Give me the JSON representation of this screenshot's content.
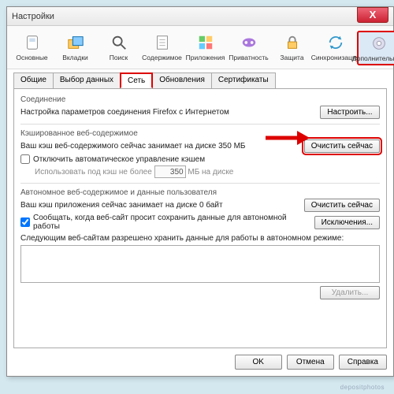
{
  "title": "Настройки",
  "close": "X",
  "toolbar": [
    {
      "id": "general",
      "label": "Основные"
    },
    {
      "id": "tabs",
      "label": "Вкладки"
    },
    {
      "id": "search",
      "label": "Поиск"
    },
    {
      "id": "content",
      "label": "Содержимое"
    },
    {
      "id": "applications",
      "label": "Приложения"
    },
    {
      "id": "privacy",
      "label": "Приватность"
    },
    {
      "id": "security",
      "label": "Защита"
    },
    {
      "id": "sync",
      "label": "Синхронизация"
    },
    {
      "id": "advanced",
      "label": "Дополнительные"
    }
  ],
  "subtabs": [
    {
      "id": "general2",
      "label": "Общие"
    },
    {
      "id": "data-choices",
      "label": "Выбор данных"
    },
    {
      "id": "network",
      "label": "Сеть"
    },
    {
      "id": "updates",
      "label": "Обновления"
    },
    {
      "id": "certificates",
      "label": "Сертификаты"
    }
  ],
  "connection": {
    "heading": "Соединение",
    "desc": "Настройка параметров соединения Firefox с Интернетом",
    "button": "Настроить..."
  },
  "cache": {
    "heading": "Кэшированное веб-содержимое",
    "desc": "Ваш кэш веб-содержимого сейчас занимает на диске 350 МБ",
    "clear": "Очистить сейчас",
    "override": "Отключить автоматическое управление кэшем",
    "limit_prefix": "Использовать под кэш не более",
    "limit_value": "350",
    "limit_suffix": "МБ на диске"
  },
  "offline": {
    "heading": "Автономное веб-содержимое и данные пользователя",
    "desc": "Ваш кэш приложения сейчас занимает на диске 0 байт",
    "clear": "Очистить сейчас",
    "notify": "Сообщать, когда веб-сайт просит сохранить данные для автономной работы",
    "exceptions": "Исключения...",
    "sites_label": "Следующим веб-сайтам разрешено хранить данные для работы в автономном режиме:",
    "remove": "Удалить..."
  },
  "footer": {
    "ok": "OK",
    "cancel": "Отмена",
    "help": "Справка"
  },
  "watermark": "depositphotos"
}
